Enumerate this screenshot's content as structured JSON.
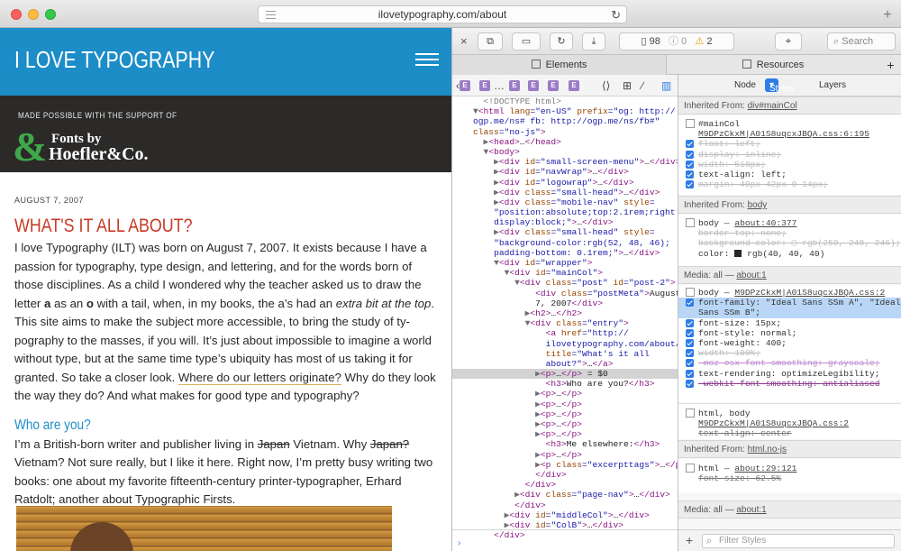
{
  "browser": {
    "url": "ilovetypography.com/about",
    "reload": "↻",
    "add_tab": "+"
  },
  "page": {
    "site_title": "I LOVE TYPOGRAPHY",
    "support_text": "MADE POSSIBLE WITH THE SUPPORT OF",
    "sponsor_line1": "Fonts by",
    "sponsor_line2": "Hoefler&Co.",
    "date": "AUGUST 7, 2007",
    "heading1": "WHAT'S IT ALL ABOUT?",
    "heading2": "Who are you?"
  },
  "inspector": {
    "close": "×",
    "doc_count": "98",
    "errors": "0",
    "warnings": "2",
    "search_placeholder": "Search",
    "tab_elements": "Elements",
    "tab_resources": "Resources",
    "tab_add": "+",
    "sidebar_tabs": [
      "Node",
      "Styles",
      "Layers"
    ],
    "filter_placeholder": "Filter Styles",
    "add_rule": "+",
    "console_prompt": "›",
    "sections": {
      "inh_main": "Inherited From: ",
      "inh_main_link": "div#mainCol",
      "inh_body": "Inherited From: ",
      "inh_body_link": "body",
      "media1": "Media: all — ",
      "media1_link": "about:1",
      "inh_html": "Inherited From: ",
      "inh_html_link": "html.no-js",
      "media2": "Media: all — ",
      "media2_link": "about:1"
    },
    "rule_main_sel": "#mainCol",
    "rule_main_src": "M9DPzCkxM|A01S8uqcxJBQA.css:6:195",
    "rule_body_sel": "body — ",
    "rule_body_src": "about:40:377",
    "rule_body2_sel": "body — ",
    "rule_body2_src": "M9DPzCkxM|A01S8uqcxJBQA.css:2",
    "rule_htmlbody_sel": "html, body",
    "rule_htmlbody_src": "M9DPzCkxM|A01S8uqcxJBQA.css:2",
    "rule_html_sel": "html — ",
    "rule_html_src": "about:29:121"
  }
}
